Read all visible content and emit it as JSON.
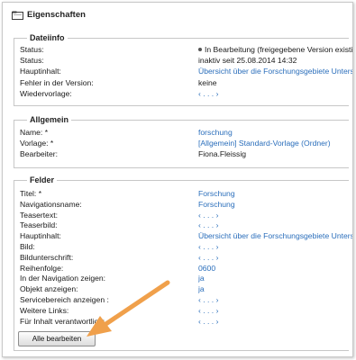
{
  "header": {
    "title": "Eigenschaften"
  },
  "dateiinfo": {
    "legend": "Dateiinfo",
    "rows": [
      {
        "label": "Status:",
        "value": "In Bearbeitung (freigegebene Version existiert)",
        "type": "dot"
      },
      {
        "label": "Status:",
        "value": "inaktiv seit 25.08.2014 14:32",
        "type": "plain"
      },
      {
        "label": "Hauptinhalt:",
        "value": "Übersicht über die Forschungsgebiete Unterseite",
        "type": "link"
      },
      {
        "label": "Fehler in der Version:",
        "value": "keine",
        "type": "plain"
      },
      {
        "label": "Wiedervorlage:",
        "value": "‹ . . . ›",
        "type": "link"
      }
    ]
  },
  "allgemein": {
    "legend": "Allgemein",
    "rows": [
      {
        "label": "Name: *",
        "value": "forschung",
        "type": "link"
      },
      {
        "label": "Vorlage: *",
        "value": "[Allgemein] Standard-Vorlage (Ordner)",
        "type": "link"
      },
      {
        "label": "Bearbeiter:",
        "value": "Fiona.Fleissig",
        "type": "plain"
      }
    ]
  },
  "felder": {
    "legend": "Felder",
    "rows": [
      {
        "label": "Titel: *",
        "value": "Forschung",
        "type": "link"
      },
      {
        "label": "Navigationsname:",
        "value": "Forschung",
        "type": "link"
      },
      {
        "label": "Teasertext:",
        "value": "‹ . . . ›",
        "type": "link"
      },
      {
        "label": "Teaserbild:",
        "value": "‹ . . . ›",
        "type": "link"
      },
      {
        "label": "Hauptinhalt:",
        "value": "Übersicht über die Forschungsgebiete Unterseite",
        "type": "link"
      },
      {
        "label": "Bild:",
        "value": "‹ . . . ›",
        "type": "link"
      },
      {
        "label": "Bildunterschrift:",
        "value": "‹ . . . ›",
        "type": "link"
      },
      {
        "label": "Reihenfolge:",
        "value": "0600",
        "type": "link"
      },
      {
        "label": "In der Navigation zeigen:",
        "value": "ja",
        "type": "link"
      },
      {
        "label": "Objekt anzeigen:",
        "value": "ja",
        "type": "link"
      },
      {
        "label": "Servicebereich anzeigen :",
        "value": "‹ . . . ›",
        "type": "link"
      },
      {
        "label": "Weitere Links:",
        "value": "‹ . . . ›",
        "type": "link"
      },
      {
        "label": "Für Inhalt verantwortlich:",
        "value": "‹ . . . ›",
        "type": "link"
      }
    ],
    "button_label": "Alle bearbeiten"
  },
  "colors": {
    "link": "#2a6ebb",
    "arrow": "#f0a04b",
    "border": "#c7c7c7"
  }
}
